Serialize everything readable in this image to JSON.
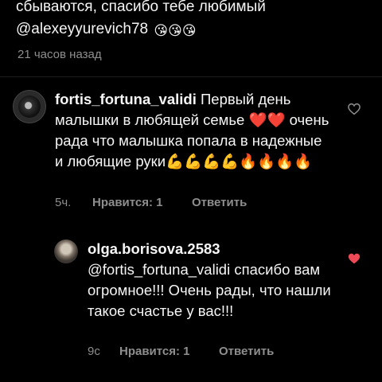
{
  "top_comment": {
    "line1": "сбываются, спасибо тебе любимый",
    "line2_mention": "@alexeyyurevich78",
    "line2_emojis": "😘😘😘",
    "time": "21 часов назад"
  },
  "comments": [
    {
      "username": "fortis_fortuna_validi",
      "text": "Первый день малышки  в любящей семье ❤️❤️ очень рада что малышка попала в надежные и любящие руки💪💪💪💪🔥🔥🔥🔥",
      "time": "5ч.",
      "likes": "Нравится: 1",
      "reply": "Ответить",
      "liked": false,
      "icon": "heart-outline-icon"
    },
    {
      "username": "olga.borisova.2583",
      "text": "@fortis_fortuna_validi спасибо вам огромное!!! Очень рады, что нашли такое счастье у вас!!!",
      "time": "9с",
      "likes": "Нравится: 1",
      "reply": "Ответить",
      "liked": true,
      "icon": "heart-filled-icon"
    }
  ],
  "colors": {
    "background": "#000000",
    "text": "#f5f5f5",
    "secondary": "#8e8e8e",
    "like": "#ed4956"
  }
}
